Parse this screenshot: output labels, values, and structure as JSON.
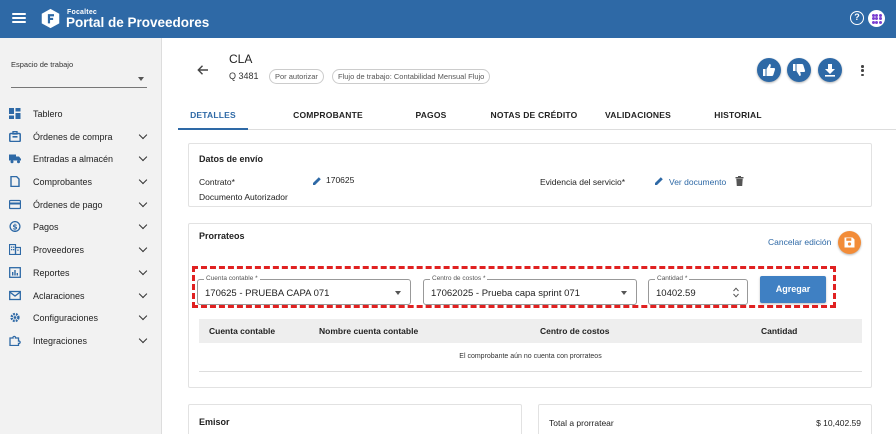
{
  "header": {
    "brand_small": "Focaltec",
    "brand_title": "Portal de Proveedores",
    "help_label": "?"
  },
  "sidebar": {
    "workspace_label": "Espacio de trabajo",
    "items": [
      {
        "label": "Tablero",
        "icon": "dashboard-icon",
        "expandable": false
      },
      {
        "label": "Órdenes de compra",
        "icon": "purchase-orders-icon",
        "expandable": true
      },
      {
        "label": "Entradas a almacén",
        "icon": "truck-icon",
        "expandable": true
      },
      {
        "label": "Comprobantes",
        "icon": "document-icon",
        "expandable": true
      },
      {
        "label": "Órdenes de pago",
        "icon": "credit-card-icon",
        "expandable": true
      },
      {
        "label": "Pagos",
        "icon": "dollar-icon",
        "expandable": true
      },
      {
        "label": "Proveedores",
        "icon": "building-icon",
        "expandable": true
      },
      {
        "label": "Reportes",
        "icon": "chart-icon",
        "expandable": true
      },
      {
        "label": "Aclaraciones",
        "icon": "mail-icon",
        "expandable": true
      },
      {
        "label": "Configuraciones",
        "icon": "gear-icon",
        "expandable": true
      },
      {
        "label": "Integraciones",
        "icon": "puzzle-icon",
        "expandable": true
      }
    ]
  },
  "document": {
    "title": "CLA",
    "id": "Q 3481",
    "status_chip": "Por autorizar",
    "workflow_chip": "Flujo de trabajo: Contabilidad Mensual Flujo"
  },
  "tabs": [
    "DETALLES",
    "COMPROBANTE",
    "PAGOS",
    "NOTAS DE CRÉDITO",
    "VALIDACIONES",
    "HISTORIAL"
  ],
  "shipping": {
    "title": "Datos de envío",
    "contract_label": "Contrato*",
    "contract_value": "170625",
    "authorized_doc_label": "Documento Autorizador",
    "evidence_label": "Evidencia del servicio*",
    "view_document_link": "Ver documento"
  },
  "prorrateos": {
    "title": "Prorrateos",
    "cancel_edit_link": "Cancelar edición",
    "account_label": "Cuenta contable *",
    "account_value": "170625 - PRUEBA CAPA 071",
    "cost_center_label": "Centro de costos *",
    "cost_center_value": "17062025 - Prueba capa sprint 071",
    "quantity_label": "Cantidad *",
    "quantity_value": "10402.59",
    "add_button": "Agregar",
    "columns": [
      "Cuenta contable",
      "Nombre cuenta contable",
      "Centro de costos",
      "Cantidad"
    ],
    "empty_message": "El comprobante aún no cuenta con prorrateos"
  },
  "issuer": {
    "title": "Emisor"
  },
  "totals": {
    "label": "Total a prorratear",
    "value": "$ 10,402.59"
  },
  "colors": {
    "primary": "#2e69a6",
    "accent": "#f28c38",
    "highlight": "#e02121"
  }
}
